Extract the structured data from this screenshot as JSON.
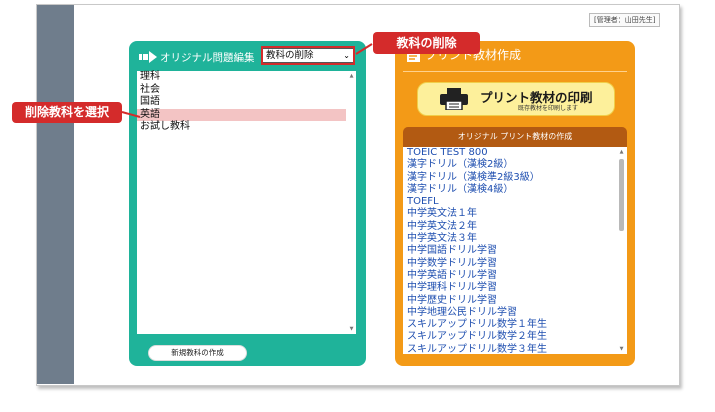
{
  "header": {
    "admin_label": "[管理者：山田先生]"
  },
  "left_panel": {
    "title": "オリジナル問題編集",
    "dropdown_value": "教科の削除",
    "items": [
      {
        "label": "理科",
        "selected": false
      },
      {
        "label": "社会",
        "selected": false
      },
      {
        "label": "国語",
        "selected": false
      },
      {
        "label": "英語",
        "selected": true
      },
      {
        "label": "お試し教科",
        "selected": false
      }
    ],
    "new_button": "新規教科の作成"
  },
  "right_panel": {
    "title": "プリント教材作成",
    "print_button_label": "プリント教材の印刷",
    "print_button_sub": "既存教材を印刷します",
    "section_title": "オリジナル プリント教材の作成",
    "items": [
      "TOEIC TEST 800",
      "漢字ドリル（漢検2級）",
      "漢字ドリル（漢検準2級3級）",
      "漢字ドリル（漢検4級）",
      "TOEFL",
      "中学英文法１年",
      "中学英文法２年",
      "中学英文法３年",
      "中学国語ドリル学習",
      "中学数学ドリル学習",
      "中学英語ドリル学習",
      "中学理科ドリル学習",
      "中学歴史ドリル学習",
      "中学地理公民ドリル学習",
      "スキルアップドリル数学１年生",
      "スキルアップドリル数学２年生",
      "スキルアップドリル数学３年生"
    ]
  },
  "callouts": {
    "delete_subject": "教科の削除",
    "select_subject": "削除教科を選択"
  },
  "colors": {
    "green_panel": "#1fb39a",
    "orange_panel": "#f39a17",
    "callout_red": "#d42b2b",
    "selected_row": "#f3c4c4"
  }
}
